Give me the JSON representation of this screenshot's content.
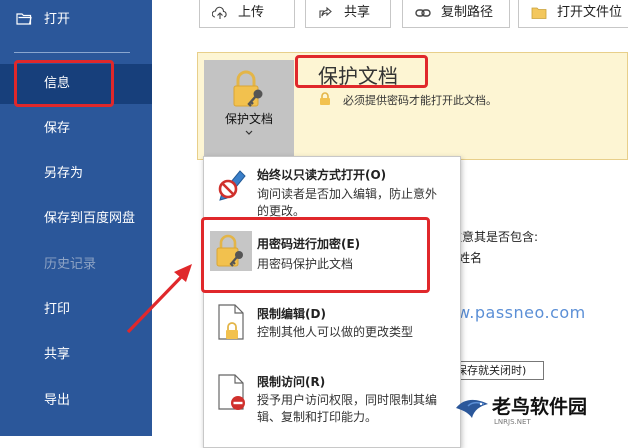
{
  "sidebar": {
    "open_label": "打开",
    "items": [
      {
        "label": "信息"
      },
      {
        "label": "保存"
      },
      {
        "label": "另存为"
      },
      {
        "label": "保存到百度网盘"
      },
      {
        "label": "历史记录"
      },
      {
        "label": "打印"
      },
      {
        "label": "共享"
      },
      {
        "label": "导出"
      }
    ]
  },
  "toolbar": {
    "upload": "上传",
    "share": "共享",
    "copy_path": "复制路径",
    "open_location": "打开文件位"
  },
  "protect": {
    "tile_label": "保护文档",
    "title": "保护文档",
    "description": "必须提供密码才能打开此文档。"
  },
  "menu": {
    "items": [
      {
        "title": "始终以只读方式打开(O)",
        "description": "询问读者是否加入编辑，防止意外的更改。"
      },
      {
        "title": "用密码进行加密(E)",
        "description": "用密码保护此文档"
      },
      {
        "title": "限制编辑(D)",
        "description": "控制其他人可以做的更改类型"
      },
      {
        "title": "限制访问(R)",
        "description": "授予用户访问权限，同时限制其编辑、复制和打印能力。"
      }
    ]
  },
  "background": {
    "inspect_partial": "注意其是否包含:",
    "name_partial": "姓名",
    "save_close_partial": "保存就关闭时)"
  },
  "watermark": "www.passneo.com",
  "logo": {
    "name": "老鸟软件园",
    "sub": "LNRJS.NET"
  },
  "colors": {
    "sidebar": "#2b579a",
    "sidebar_active": "#173f7b",
    "highlight_box": "#e0282b",
    "panel": "#fdf5d3"
  }
}
